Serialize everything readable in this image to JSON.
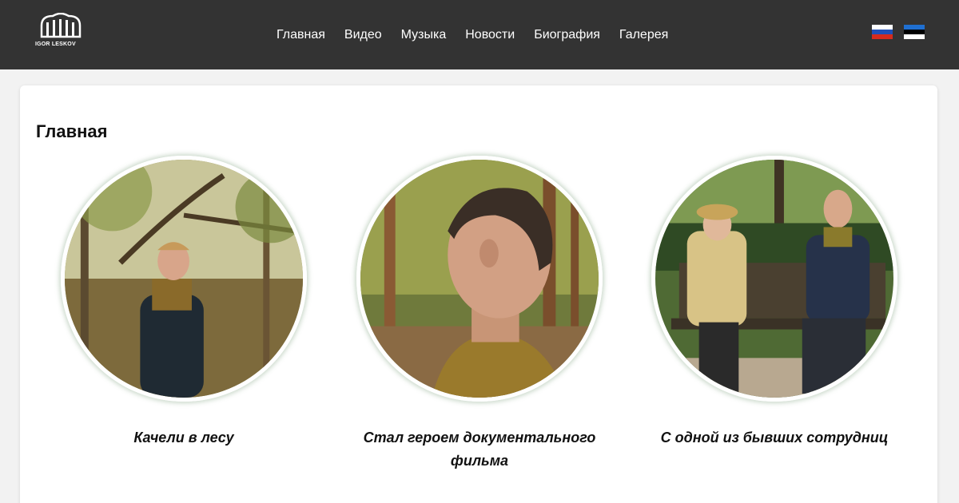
{
  "header": {
    "logo_text": "IGOR LESKOV",
    "nav": [
      {
        "label": "Главная"
      },
      {
        "label": "Видео"
      },
      {
        "label": "Музыка"
      },
      {
        "label": "Новости"
      },
      {
        "label": "Биография"
      },
      {
        "label": "Галерея"
      }
    ],
    "languages": [
      {
        "icon": "russia-flag-icon",
        "colors": [
          "#ffffff",
          "#1f4fb8",
          "#d52b1e"
        ]
      },
      {
        "icon": "estonia-flag-icon",
        "colors": [
          "#1f6fd1",
          "#000000",
          "#ffffff"
        ]
      }
    ]
  },
  "main": {
    "title": "Главная",
    "items": [
      {
        "caption": "Качели в лесу",
        "icon": "forest-swing-photo"
      },
      {
        "caption": "Стал героем документального фильма",
        "icon": "profile-portrait-photo"
      },
      {
        "caption": "С одной из бывших сотрудниц",
        "icon": "park-bench-photo"
      }
    ]
  },
  "colors": {
    "header_bg": "#333333",
    "page_bg": "#f2f2f2",
    "card_bg": "#ffffff"
  }
}
